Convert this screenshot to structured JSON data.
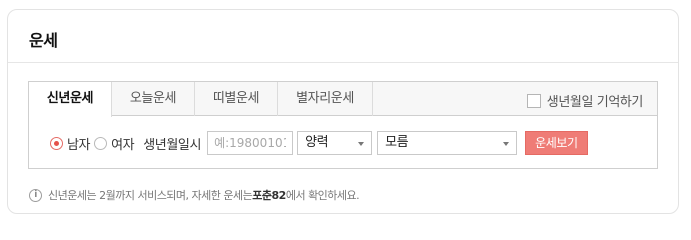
{
  "card": {
    "title": "운세"
  },
  "tabs": [
    {
      "label": "신년운세",
      "active": true
    },
    {
      "label": "오늘운세",
      "active": false
    },
    {
      "label": "띠별운세",
      "active": false
    },
    {
      "label": "별자리운세",
      "active": false
    }
  ],
  "remember_label": "생년월일 기억하기",
  "form": {
    "gender_male": "남자",
    "gender_female": "여자",
    "birth_label": "생년월일시",
    "birth_placeholder": "예:19800101",
    "calendar_value": "양력",
    "time_value": "모름",
    "submit_label": "운세보기"
  },
  "notice": {
    "prefix": "신년운세는 2월까지 서비스되며, 자세한 운세는 ",
    "highlight": "포춘82",
    "suffix": "에서 확인하세요."
  },
  "colors": {
    "accent": "#ef7c76",
    "radio": "#e5524b"
  }
}
